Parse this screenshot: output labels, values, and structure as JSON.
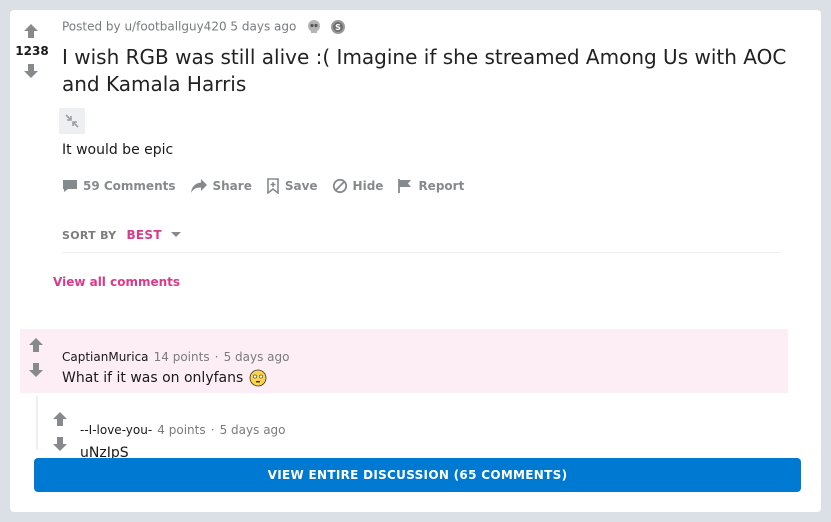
{
  "post": {
    "score": "1238",
    "posted_by": "Posted by u/footballguy420",
    "age": "5 days ago",
    "title": "I wish RGB was still alive :( Imagine if she streamed Among Us with AOC and Kamala Harris",
    "body": "It would be epic",
    "awards": [
      {
        "icon": "award-skull-icon",
        "color": "#a0a0a0"
      },
      {
        "icon": "award-coin-icon",
        "color": "#8a8a8a"
      }
    ]
  },
  "actions": {
    "comments": "59 Comments",
    "share": "Share",
    "save": "Save",
    "hide": "Hide",
    "report": "Report"
  },
  "sort": {
    "label": "SORT BY",
    "value": "BEST"
  },
  "view_all": "View all comments",
  "comments": [
    {
      "author": "CaptianMurica",
      "points": "14 points",
      "age": "5 days ago",
      "text": "What if it was on onlyfans",
      "emoji": "flushed-face-icon"
    },
    {
      "author": "--I-love-you-",
      "points": "4 points",
      "age": "5 days ago",
      "text": "uNzIpS"
    }
  ],
  "view_entire": "VIEW ENTIRE DISCUSSION (65 COMMENTS)",
  "colors": {
    "accent": "#d93a8a",
    "button": "#0079d3",
    "highlight": "#fdeef5"
  }
}
